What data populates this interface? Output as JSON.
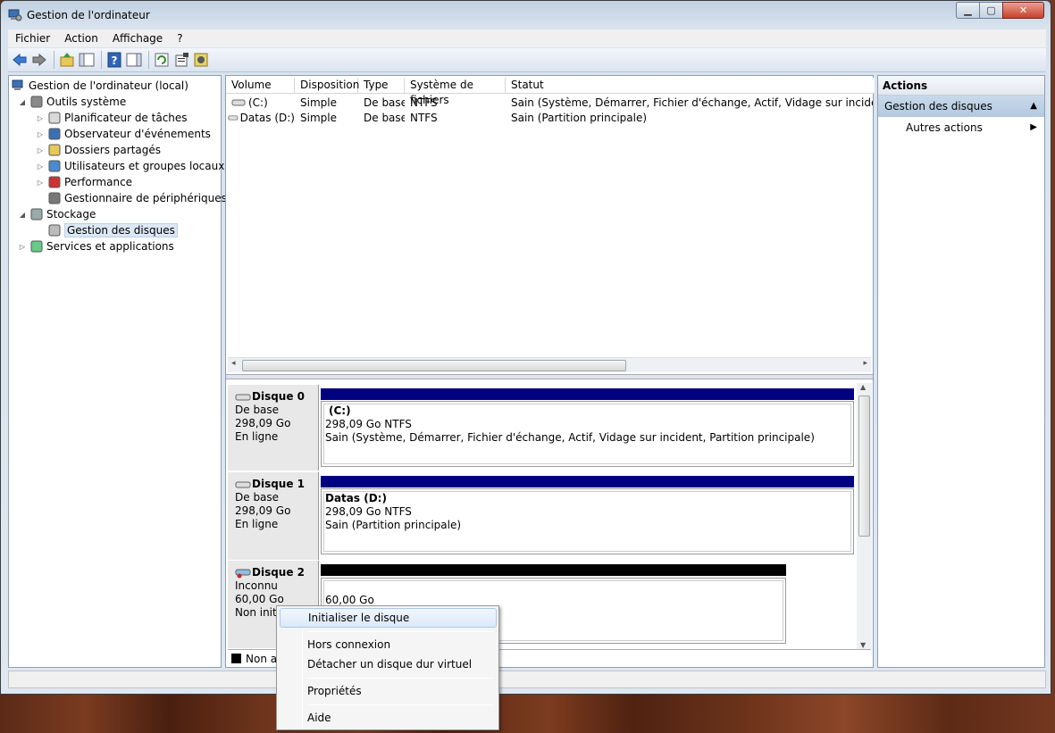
{
  "window": {
    "title": "Gestion de l'ordinateur"
  },
  "menu": [
    "Fichier",
    "Action",
    "Affichage",
    "?"
  ],
  "toolbar": {
    "icons": [
      "back-icon",
      "forward-icon",
      "up-folder-icon",
      "show-hide-tree-icon",
      "help-icon",
      "show-hide-action-icon",
      "refresh-icon",
      "properties-icon",
      "settings-icon"
    ]
  },
  "tree": {
    "root": "Gestion de l'ordinateur (local)",
    "items": [
      {
        "label": "Outils système",
        "level": 1,
        "icon": "tools-icon",
        "expand": "open"
      },
      {
        "label": "Planificateur de tâches",
        "level": 2,
        "icon": "clock-icon",
        "expand": "closed"
      },
      {
        "label": "Observateur d'événements",
        "level": 2,
        "icon": "event-viewer-icon",
        "expand": "closed"
      },
      {
        "label": "Dossiers partagés",
        "level": 2,
        "icon": "shared-folder-icon",
        "expand": "closed"
      },
      {
        "label": "Utilisateurs et groupes locaux",
        "level": 2,
        "icon": "users-icon",
        "expand": "closed"
      },
      {
        "label": "Performance",
        "level": 2,
        "icon": "performance-icon",
        "expand": "closed"
      },
      {
        "label": "Gestionnaire de périphériques",
        "level": 2,
        "icon": "device-manager-icon",
        "expand": "none"
      },
      {
        "label": "Stockage",
        "level": 1,
        "icon": "storage-icon",
        "expand": "open"
      },
      {
        "label": "Gestion des disques",
        "level": 2,
        "icon": "disk-management-icon",
        "expand": "none",
        "selected": true
      },
      {
        "label": "Services et applications",
        "level": 1,
        "icon": "services-icon",
        "expand": "closed"
      }
    ]
  },
  "volumes": {
    "headers": [
      "Volume",
      "Disposition",
      "Type",
      "Système de fichiers",
      "Statut"
    ],
    "rows": [
      [
        "(C:)",
        "Simple",
        "De base",
        "NTFS",
        "Sain (Système, Démarrer, Fichier d'échange, Actif, Vidage sur incident, Partitio"
      ],
      [
        "Datas (D:)",
        "Simple",
        "De base",
        "NTFS",
        "Sain (Partition principale)"
      ]
    ]
  },
  "disks": [
    {
      "name": "Disque 0",
      "type": "De base",
      "size": "298,09 Go",
      "status": "En ligne",
      "part_name": "(C:)",
      "part_size": "298,09 Go NTFS",
      "part_status": "Sain (Système, Démarrer, Fichier d'échange, Actif, Vidage sur incident, Partition principale)"
    },
    {
      "name": "Disque 1",
      "type": "De base",
      "size": "298,09 Go",
      "status": "En ligne",
      "part_name": "Datas  (D:)",
      "part_size": "298,09 Go NTFS",
      "part_status": "Sain (Partition principale)"
    },
    {
      "name": "Disque 2",
      "type": "Inconnu",
      "size": "60,00 Go",
      "status": "Non initia",
      "part_name": "",
      "part_size": "60,00 Go",
      "part_status": ""
    }
  ],
  "legend": {
    "label": "Non al"
  },
  "actions": {
    "title": "Actions",
    "section": "Gestion des disques",
    "item": "Autres actions"
  },
  "context_menu": {
    "items": [
      "Initialiser le disque",
      "Hors connexion",
      "Détacher un disque dur virtuel",
      "Propriétés",
      "Aide"
    ]
  },
  "colors": {
    "partition_bar": "#000080",
    "unallocated_bar": "#000000"
  }
}
